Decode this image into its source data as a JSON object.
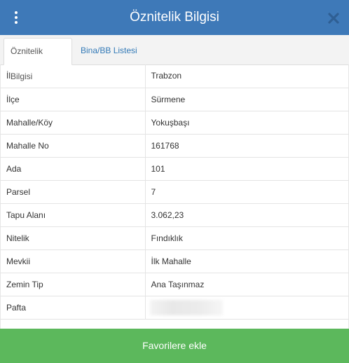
{
  "header": {
    "title": "Öznitelik Bilgisi",
    "close_glyph": "✖",
    "menu_icon": "vertical-dots-icon",
    "close_icon": "close-icon"
  },
  "tabs": [
    {
      "label": "Öznitelik Bilgisi",
      "active": true
    },
    {
      "label": "Bina/BB Listesi",
      "active": false
    }
  ],
  "rows": [
    {
      "key": "İl",
      "value": "Trabzon"
    },
    {
      "key": "İlçe",
      "value": "Sürmene"
    },
    {
      "key": "Mahalle/Köy",
      "value": "Yokuşbaşı"
    },
    {
      "key": "Mahalle No",
      "value": "161768"
    },
    {
      "key": "Ada",
      "value": "101"
    },
    {
      "key": "Parsel",
      "value": "7"
    },
    {
      "key": "Tapu Alanı",
      "value": "3.062,23"
    },
    {
      "key": "Nitelik",
      "value": "Fındıklık"
    },
    {
      "key": "Mevkii",
      "value": "İlk Mahalle"
    },
    {
      "key": "Zemin Tip",
      "value": "Ana Taşınmaz"
    },
    {
      "key": "Pafta",
      "value": ""
    }
  ],
  "footer": {
    "favorite_label": "Favorilere ekle"
  },
  "colors": {
    "header": "#3e79b8",
    "button": "#5cb85c",
    "link": "#337ab7"
  }
}
